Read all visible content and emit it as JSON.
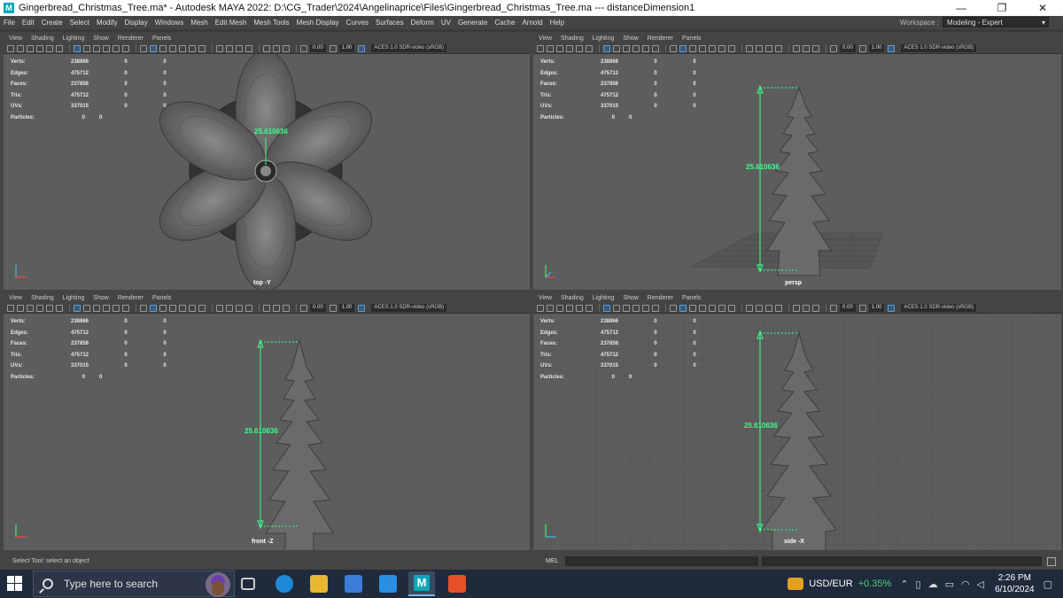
{
  "window": {
    "logo_letter": "M",
    "title": "Gingerbread_Christmas_Tree.ma* - Autodesk MAYA 2022: D:\\CG_Trader\\2024\\Angelinaprice\\Files\\Gingerbread_Christmas_Tree.ma   ---   distanceDimension1",
    "min_icon": "—",
    "max_icon": "❐",
    "close_icon": "✕"
  },
  "menubar": {
    "items": [
      "File",
      "Edit",
      "Create",
      "Select",
      "Modify",
      "Display",
      "Windows",
      "Mesh",
      "Edit Mesh",
      "Mesh Tools",
      "Mesh Display",
      "Curves",
      "Surfaces",
      "Deform",
      "UV",
      "Generate",
      "Cache",
      "Arnold",
      "Help"
    ],
    "workspace_label": "Workspace :",
    "workspace_value": "Modeling - Expert"
  },
  "panel_menu": [
    "View",
    "Shading",
    "Lighting",
    "Show",
    "Renderer",
    "Panels"
  ],
  "toolbar": {
    "exposure": "0.00",
    "gamma": "1.00",
    "color_space": "ACES 1.0 SDR-video (sRGB)"
  },
  "hud": {
    "labels": [
      "Verts:",
      "Edges:",
      "Faces:",
      "Tris:",
      "UVs:"
    ],
    "particles_label": "Particles:",
    "rows": [
      [
        "238866",
        "0",
        "0"
      ],
      [
        "475712",
        "0",
        "0"
      ],
      [
        "237856",
        "0",
        "0"
      ],
      [
        "475712",
        "0",
        "0"
      ],
      [
        "337015",
        "0",
        "0"
      ]
    ],
    "particles": [
      "0",
      "0"
    ]
  },
  "viewports": {
    "top": {
      "camera": "top -Y",
      "distance": "25.610636"
    },
    "persp": {
      "camera": "persp",
      "distance": "25.610636"
    },
    "front": {
      "camera": "front -Z",
      "distance": "25.610636"
    },
    "side": {
      "camera": "side -X",
      "distance": "25.610636"
    }
  },
  "statusline": {
    "help": "Select Tool: select an object",
    "mel_label": "MEL"
  },
  "taskbar": {
    "search_placeholder": "Type here to search",
    "ticker": "USD/EUR",
    "ticker_change": "+0.35%",
    "time": "2:26 PM",
    "date": "6/10/2024",
    "app_icons": [
      "task-view-icon",
      "edge-icon",
      "file-explorer-icon",
      "store-icon",
      "mail-icon",
      "maya-icon",
      "brave-icon"
    ]
  },
  "colors": {
    "dimension": "#3cff8c",
    "viewport_bg": "#5d5d5d",
    "chrome": "#444444",
    "taskbar": "#1f2a3c"
  }
}
